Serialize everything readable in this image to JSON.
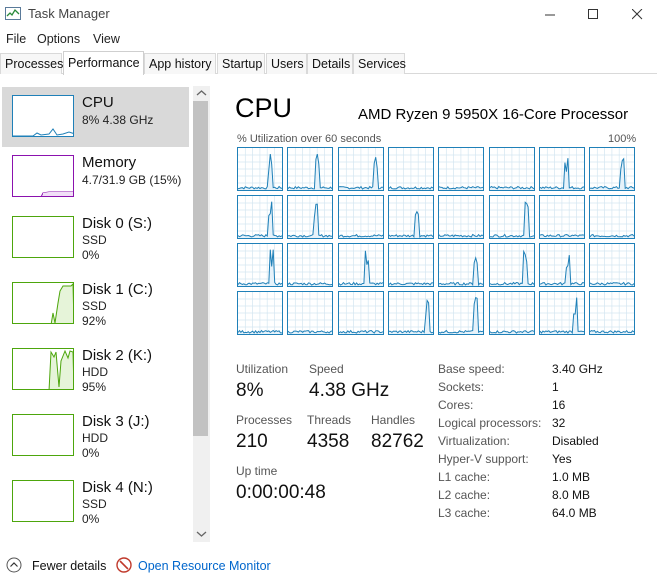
{
  "window": {
    "title": "Task Manager"
  },
  "menu": [
    "File",
    "Options",
    "View"
  ],
  "tabs": [
    "Processes",
    "Performance",
    "App history",
    "Startup",
    "Users",
    "Details",
    "Services"
  ],
  "active_tab": "Performance",
  "sidebar": [
    {
      "name": "CPU",
      "line1": "8%  4.38 GHz",
      "line2": "",
      "color": "#1f80b8"
    },
    {
      "name": "Memory",
      "line1": "4.7/31.9 GB (15%)",
      "line2": "",
      "color": "#8b12ae"
    },
    {
      "name": "Disk 0 (S:)",
      "line1": "SSD",
      "line2": "0%",
      "color": "#4da60c"
    },
    {
      "name": "Disk 1 (C:)",
      "line1": "SSD",
      "line2": "92%",
      "color": "#4da60c"
    },
    {
      "name": "Disk 2 (K:)",
      "line1": "HDD",
      "line2": "95%",
      "color": "#4da60c"
    },
    {
      "name": "Disk 3 (J:)",
      "line1": "HDD",
      "line2": "0%",
      "color": "#4da60c"
    },
    {
      "name": "Disk 4 (N:)",
      "line1": "SSD",
      "line2": "0%",
      "color": "#4da60c"
    }
  ],
  "main": {
    "title": "CPU",
    "model": "AMD Ryzen 9 5950X 16-Core Processor",
    "util_caption": "% Utilization over 60 seconds",
    "util_max": "100%",
    "logical_processors": 32
  },
  "stats": {
    "utilization_label": "Utilization",
    "utilization": "8%",
    "speed_label": "Speed",
    "speed": "4.38 GHz",
    "processes_label": "Processes",
    "processes": "210",
    "threads_label": "Threads",
    "threads": "4358",
    "handles_label": "Handles",
    "handles": "82762",
    "uptime_label": "Up time",
    "uptime": "0:00:00:48"
  },
  "details": [
    {
      "label": "Base speed:",
      "value": "3.40 GHz"
    },
    {
      "label": "Sockets:",
      "value": "1"
    },
    {
      "label": "Cores:",
      "value": "16"
    },
    {
      "label": "Logical processors:",
      "value": "32"
    },
    {
      "label": "Virtualization:",
      "value": "Disabled"
    },
    {
      "label": "Hyper-V support:",
      "value": "Yes"
    },
    {
      "label": "L1 cache:",
      "value": "1.0 MB"
    },
    {
      "label": "L2 cache:",
      "value": "8.0 MB"
    },
    {
      "label": "L3 cache:",
      "value": "64.0 MB"
    }
  ],
  "footer": {
    "fewer_details": "Fewer details",
    "open_monitor": "Open Resource Monitor"
  },
  "colors": {
    "cpu": "#1f80b8",
    "memory": "#8b12ae",
    "disk": "#4da60c",
    "link": "#0066cc"
  }
}
